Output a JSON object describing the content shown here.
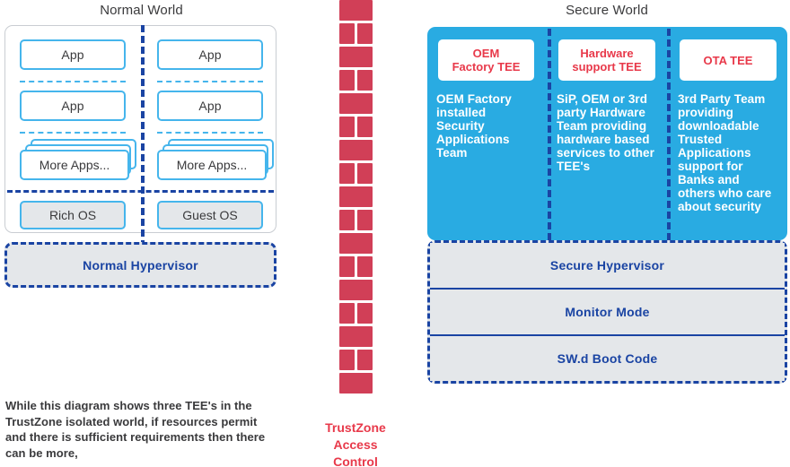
{
  "normal_world": {
    "title": "Normal World",
    "columns": [
      {
        "apps": [
          "App",
          "App"
        ],
        "more_apps": "More Apps...",
        "os": "Rich OS"
      },
      {
        "apps": [
          "App",
          "App"
        ],
        "more_apps": "More Apps...",
        "os": "Guest OS"
      }
    ],
    "hypervisor": "Normal Hypervisor"
  },
  "trustzone": {
    "label_lines": [
      "TrustZone",
      "Access",
      "Control"
    ],
    "brick_color": "#d13f57",
    "label_color": "#e8394a"
  },
  "secure_world": {
    "title": "Secure World",
    "panel_color": "#29abe2",
    "tee_title_color": "#e8394a",
    "columns": [
      {
        "header": "OEM\nFactory TEE",
        "header_lines": [
          "OEM",
          "Factory TEE"
        ],
        "description": "OEM Factory installed Security Applications Team"
      },
      {
        "header": "Hardware\nsupport TEE",
        "header_lines": [
          "Hardware",
          "support TEE"
        ],
        "description": "SiP, OEM or 3rd party Hardware Team providing hardware based services to other TEE's"
      },
      {
        "header": "OTA TEE",
        "header_lines": [
          "OTA TEE"
        ],
        "description": "3rd Party Team providing downloadable Trusted Applications support for Banks and others who care about security"
      }
    ],
    "platform_bars": [
      "Secure Hypervisor",
      "Monitor Mode",
      "SW.d Boot Code"
    ]
  },
  "footnote": "While this diagram shows three TEE's in the TrustZone isolated world, if resources permit and there is sufficient requirements then there can be more,",
  "colors": {
    "accent_blue": "#45b5ec",
    "deep_blue": "#1a44a3",
    "panel_blue": "#29abe2",
    "red": "#e8394a",
    "brick_red": "#d13f57",
    "gray_fill": "#e4e7ea",
    "text_dark": "#3a3a3c"
  }
}
